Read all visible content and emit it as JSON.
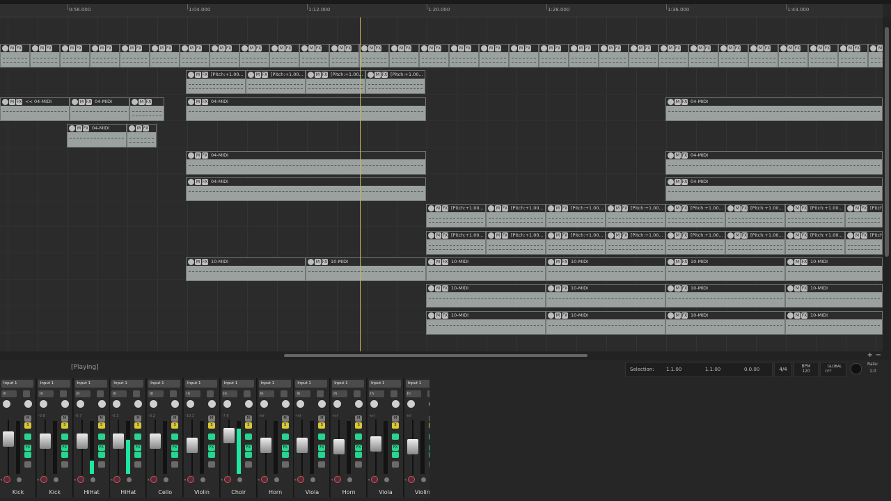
{
  "timeline": {
    "markers": [
      "0:56.000",
      "1:04.000",
      "1:12.000",
      "1:20.000",
      "1:28.000",
      "1:36.000",
      "1:44.000"
    ]
  },
  "items": {
    "midi_glued": "03-MIDI-glued",
    "pitch": "[Pitch:+1.00...",
    "midi_04_rev": "<< 04-MIDI",
    "midi_04": "04-MIDI",
    "midi_10": "10-MIDI",
    "btn_m": "M",
    "btn_fx": "FX"
  },
  "transport": {
    "status": "[Playing]",
    "selection_label": "Selection:",
    "sel_start": "1.1.00",
    "sel_end": "1.1.00",
    "sel_len": "0.0.00",
    "timesig": "4/4",
    "bpm_label": "BPM",
    "bpm": "120",
    "global_label": "GLOBAL",
    "global_state": "OFF",
    "rate_label": "Rate:",
    "rate": "1.0"
  },
  "mixer": {
    "input_label": "Input 1",
    "in_label": "in",
    "mute": "M",
    "solo": "S",
    "fx": "FX",
    "strips": [
      {
        "name": "Kick",
        "vol": "",
        "fader": 0.7,
        "meter": 0.0
      },
      {
        "name": "Kick",
        "vol": "-0.8",
        "fader": 0.66,
        "meter": 0.0
      },
      {
        "name": "HiHat",
        "vol": "-0.7",
        "fader": 0.66,
        "meter": 0.25
      },
      {
        "name": "HiHat",
        "vol": "-0.3",
        "fader": 0.66,
        "meter": 0.65
      },
      {
        "name": "Cello",
        "vol": "-0.2",
        "fader": 0.66,
        "meter": 0.0
      },
      {
        "name": "Violin",
        "vol": "-10.3",
        "fader": 0.55,
        "meter": 0.0
      },
      {
        "name": "Choir",
        "vol": "-7.6",
        "fader": 0.8,
        "meter": 0.85
      },
      {
        "name": "Horn",
        "vol": "-inf",
        "fader": 0.55,
        "meter": 0.0
      },
      {
        "name": "Viola",
        "vol": "-inf",
        "fader": 0.55,
        "meter": 0.0
      },
      {
        "name": "Horn",
        "vol": "-inf",
        "fader": 0.52,
        "meter": 0.0
      },
      {
        "name": "Viola",
        "vol": "-inf",
        "fader": 0.58,
        "meter": 0.0
      },
      {
        "name": "Violin",
        "vol": "-inf",
        "fader": 0.52,
        "meter": 0.0
      }
    ]
  },
  "colors": {
    "meter": "#1fe6a0",
    "solo": "#d8c83a",
    "fx": "#27d58f",
    "record": "#cc5566",
    "playhead": "#c9b95a"
  }
}
